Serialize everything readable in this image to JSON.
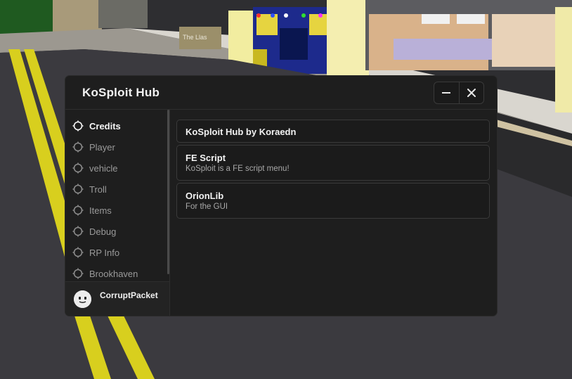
{
  "window": {
    "title": "KoSploit Hub",
    "minimize_icon": "minus-icon",
    "close_icon": "close-icon"
  },
  "sidebar": {
    "items": [
      {
        "label": "Credits",
        "icon": "tab-circle-icon",
        "active": true
      },
      {
        "label": "Player",
        "icon": "tab-circle-icon",
        "active": false
      },
      {
        "label": "vehicle",
        "icon": "tab-circle-icon",
        "active": false
      },
      {
        "label": "Troll",
        "icon": "tab-circle-icon",
        "active": false
      },
      {
        "label": "Items",
        "icon": "tab-circle-icon",
        "active": false
      },
      {
        "label": "Debug",
        "icon": "tab-circle-icon",
        "active": false
      },
      {
        "label": "RP Info",
        "icon": "tab-circle-icon",
        "active": false
      },
      {
        "label": "Brookhaven",
        "icon": "tab-circle-icon",
        "active": false
      }
    ]
  },
  "profile": {
    "username": "CorruptPacket",
    "avatar_icon": "roblox-face-avatar"
  },
  "content": {
    "cards": [
      {
        "title": "KoSploit Hub by Koraedn",
        "description": ""
      },
      {
        "title": "FE Script",
        "description": "KoSploit is a FE script menu!"
      },
      {
        "title": "OrionLib",
        "description": "For the GUI"
      }
    ]
  },
  "scene": {
    "shop_sign": "The Llas"
  },
  "colors": {
    "window_bg": "#1e1e1e",
    "card_border": "#3a3a3a",
    "road_line": "#d8cf1e",
    "text_primary": "#f2f2f2",
    "text_muted": "#9a9a9a"
  }
}
